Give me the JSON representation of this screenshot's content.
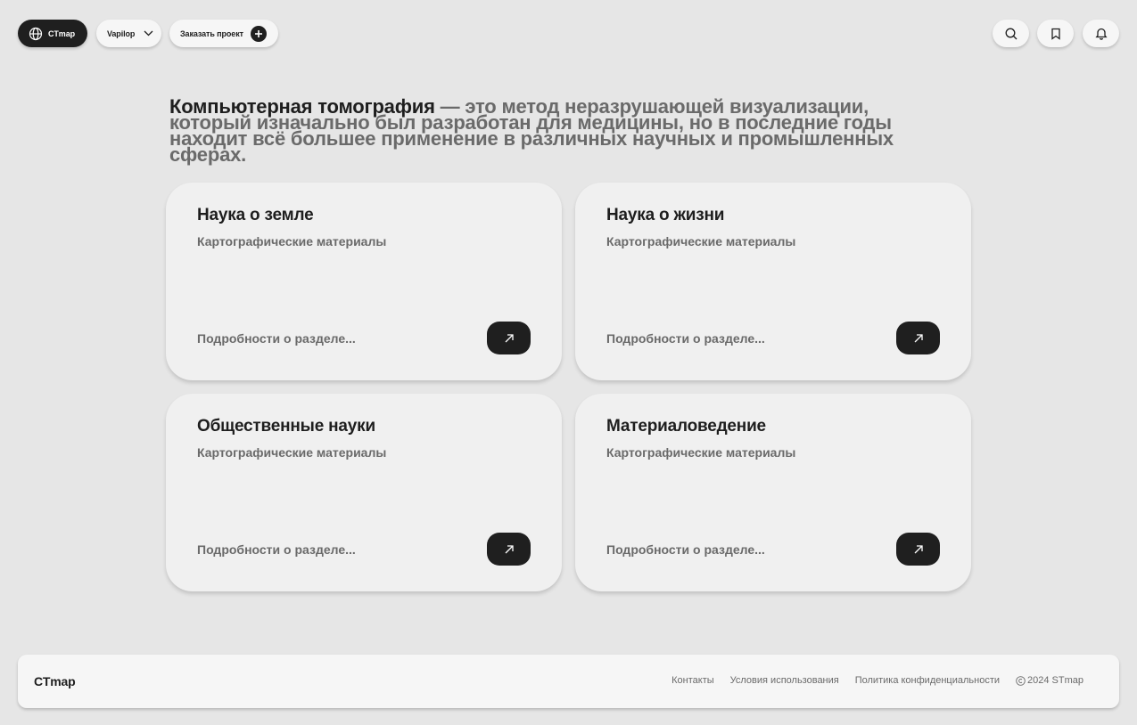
{
  "header": {
    "brand_label": "CTmap",
    "language_label": "Vapilop",
    "order_label": "Заказать проект",
    "icons": [
      "globe-icon",
      "chevron-down-icon",
      "plus-icon",
      "search-icon",
      "bookmark-icon",
      "bell-icon"
    ]
  },
  "intro": {
    "strong": "Компьютерная томография",
    "rest": " — это метод неразрушающей визуализации, который изначально был разработан для медицины, но в последние годы находит всё большее применение в различных научных и промышленных сферах."
  },
  "cards": [
    {
      "title": "Наука о земле",
      "subtitle": "Картографические материалы",
      "more": "Подробности о разделе..."
    },
    {
      "title": "Наука о жизни",
      "subtitle": "Картографические материалы",
      "more": "Подробности о разделе..."
    },
    {
      "title": "Общественные науки",
      "subtitle": "Картографические материалы",
      "more": "Подробности о разделе..."
    },
    {
      "title": "Материаловедение",
      "subtitle": "Картографические материалы",
      "more": "Подробности о разделе..."
    }
  ],
  "footer": {
    "logo": "CTmap",
    "links": [
      "Контакты",
      "Условия использования",
      "Политика конфиденциальности"
    ],
    "copyright": "2024 STmap"
  },
  "colors": {
    "background": "#e6e6e6",
    "card": "#f0f0f0",
    "dark": "#1f1f1f",
    "muted_text": "#6a6a6a"
  }
}
